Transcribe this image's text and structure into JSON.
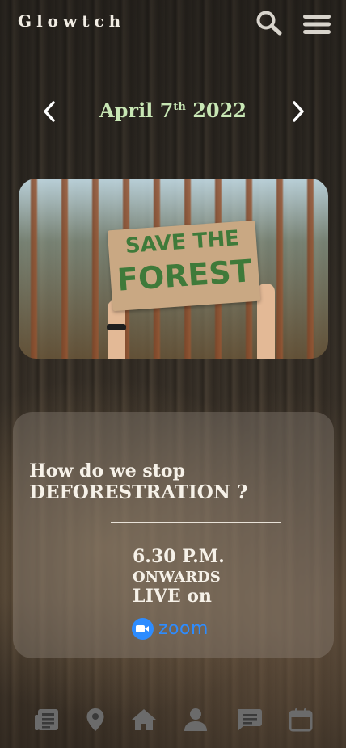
{
  "app": {
    "brand": "Glowtch"
  },
  "header": {
    "search_icon": "search-icon",
    "menu_icon": "hamburger-menu-icon"
  },
  "date": {
    "month_day": "April 7",
    "suffix": "th",
    "year": "2022"
  },
  "hero": {
    "sign_line1": "SAVE THE",
    "sign_line2": "FOREST"
  },
  "event": {
    "question_line1": "How do we stop",
    "question_line2": "DEFORESTRATION ?",
    "time": "6.30 P.M.",
    "onwards": "ONWARDS",
    "live_on": "LIVE on",
    "platform": "zoom"
  },
  "nav": {
    "items": [
      {
        "icon": "news-icon"
      },
      {
        "icon": "location-pin-icon"
      },
      {
        "icon": "home-icon"
      },
      {
        "icon": "profile-icon"
      },
      {
        "icon": "chat-icon"
      },
      {
        "icon": "calendar-icon"
      }
    ]
  },
  "colors": {
    "accent_date": "#c7e6b4",
    "zoom_blue": "#2d8cff",
    "icon_gray": "#6b6b6b"
  }
}
